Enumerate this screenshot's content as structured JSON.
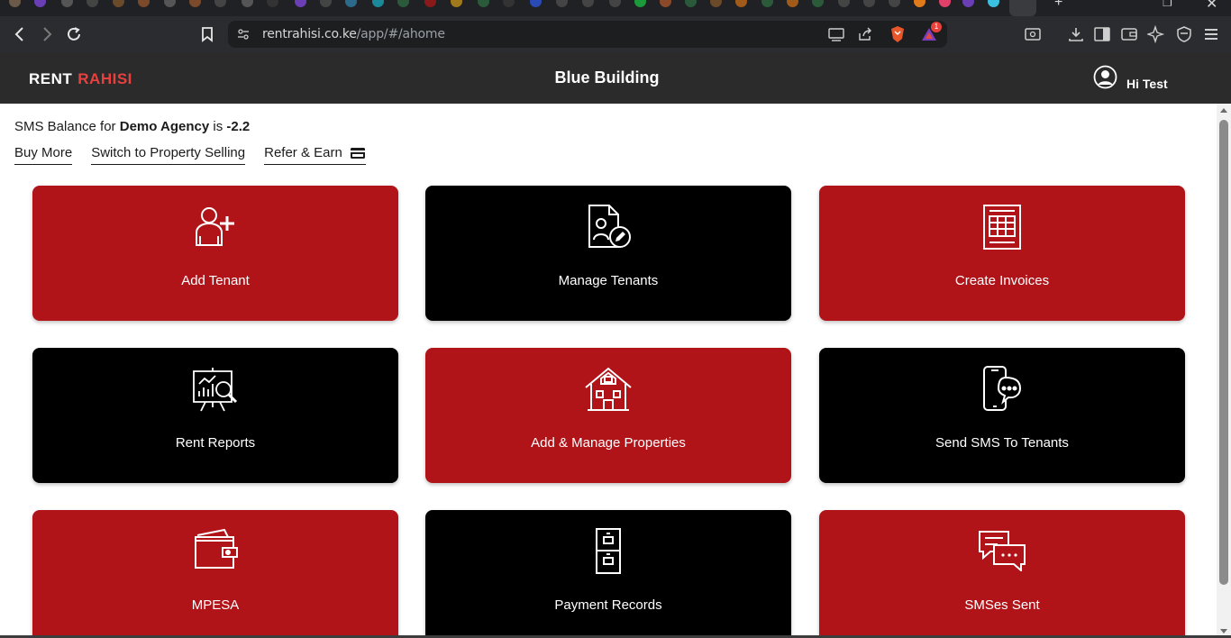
{
  "browser": {
    "url_host": "rentrahisi.co.ke",
    "url_path": "/app/#/ahome",
    "notification_count": "1"
  },
  "header": {
    "brand_rent": "RENT",
    "brand_rahisi": "RAHISI",
    "building_name": "Blue Building",
    "greeting": "Hi Test",
    "brand_accent_color": "#e8403f"
  },
  "sms": {
    "prefix": "SMS Balance for",
    "agency": "Demo Agency",
    "middle": "is",
    "balance": "-2.2"
  },
  "links": {
    "buy_more": "Buy More",
    "switch_selling": "Switch to Property Selling",
    "refer_earn": "Refer & Earn"
  },
  "cards": [
    {
      "label": "Add Tenant",
      "icon": "add-user-icon",
      "color": "#b01419"
    },
    {
      "label": "Manage Tenants",
      "icon": "tenant-document-icon",
      "color": "#000000"
    },
    {
      "label": "Create Invoices",
      "icon": "invoice-sheet-icon",
      "color": "#b01419"
    },
    {
      "label": "Rent Reports",
      "icon": "report-chart-icon",
      "color": "#000000"
    },
    {
      "label": "Add & Manage Properties",
      "icon": "house-icon",
      "color": "#b01419"
    },
    {
      "label": "Send SMS To Tenants",
      "icon": "phone-chat-icon",
      "color": "#000000"
    },
    {
      "label": "MPESA",
      "icon": "wallet-icon",
      "color": "#b01419"
    },
    {
      "label": "Payment Records",
      "icon": "filing-cabinet-icon",
      "color": "#000000"
    },
    {
      "label": "SMSes Sent",
      "icon": "chat-bubbles-icon",
      "color": "#b01419"
    }
  ]
}
